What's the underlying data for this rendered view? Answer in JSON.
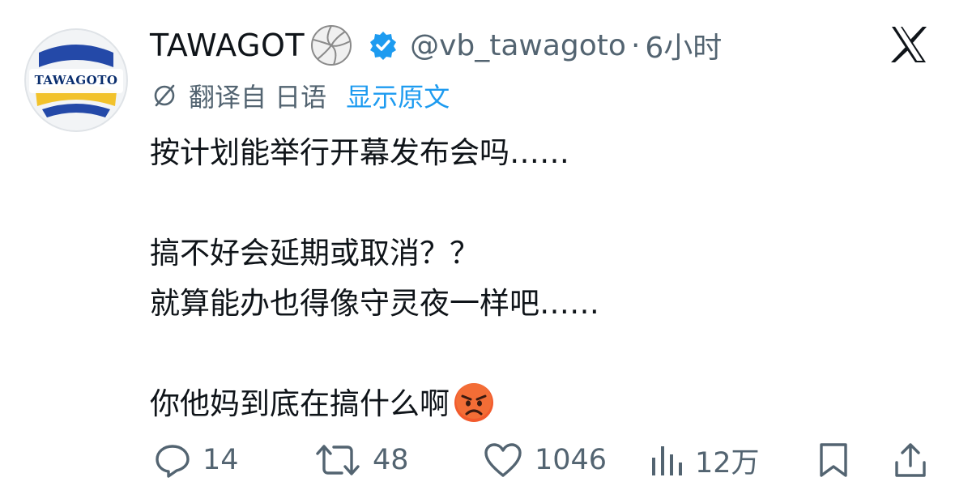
{
  "author": {
    "display_name": "TAWAGOT",
    "name_emoji": "volleyball",
    "verified": true,
    "handle": "@vb_tawagoto",
    "separator": "·",
    "time": "6小时",
    "avatar_text": "TAWAGOTO"
  },
  "platform_logo": "x-logo",
  "translation": {
    "icon": "translate-icon",
    "label": "翻译自 日语",
    "show_original": "显示原文"
  },
  "tweet": {
    "line1": "按计划能举行开幕发布会吗……",
    "line2": "搞不好会延期或取消？？",
    "line3": "就算能办也得像守灵夜一样吧……",
    "line4": "你他妈到底在搞什么啊",
    "line4_emoji": "angry-face"
  },
  "actions": {
    "reply_count": "14",
    "retweet_count": "48",
    "like_count": "1046",
    "views_count": "12万"
  },
  "colors": {
    "primary_text": "#0f1419",
    "secondary_text": "#536471",
    "accent": "#1d9bf0"
  }
}
